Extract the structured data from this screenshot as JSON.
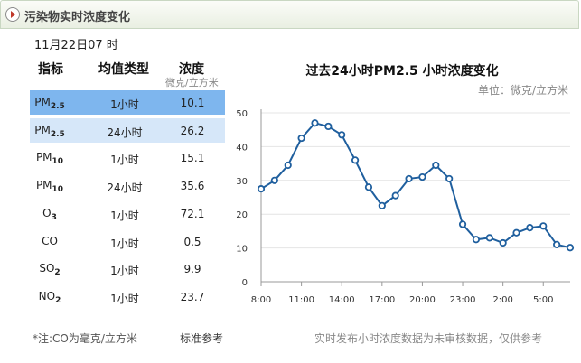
{
  "window": {
    "title": "污染物实时浓度变化"
  },
  "datetime": "11月22日07 时",
  "table": {
    "headers": {
      "indicator": "指标",
      "avg_type": "均值类型",
      "concentration": "浓度"
    },
    "unit": "微克/立方米",
    "rows": [
      {
        "base": "PM",
        "sub": "2.5",
        "type": "1小时",
        "value": "10.1"
      },
      {
        "base": "PM",
        "sub": "2.5",
        "type": "24小时",
        "value": "26.2"
      },
      {
        "base": "PM",
        "sub": "10",
        "type": "1小时",
        "value": "15.1"
      },
      {
        "base": "PM",
        "sub": "10",
        "type": "24小时",
        "value": "35.6"
      },
      {
        "base": "O",
        "sub": "3",
        "type": "1小时",
        "value": "72.1"
      },
      {
        "base": "CO",
        "sub": "",
        "type": "1小时",
        "value": "0.5"
      },
      {
        "base": "SO",
        "sub": "2",
        "type": "1小时",
        "value": "9.9"
      },
      {
        "base": "NO",
        "sub": "2",
        "type": "1小时",
        "value": "23.7"
      }
    ]
  },
  "footer": {
    "note": "*注:CO为毫克/立方米",
    "standard_link": "标准参考",
    "disclaimer": "实时发布小时浓度数据为未审核数据，仅供参考"
  },
  "colors": {
    "line": "#1f5f9e",
    "highlight_row": "#7eb6ee",
    "light_row": "#d6e7f9"
  },
  "chart_data": {
    "type": "line",
    "title": "过去24小时PM2.5 小时浓度变化",
    "unit_label": "单位：微克/立方米",
    "ylim": [
      0,
      50
    ],
    "yticks": [
      0,
      10,
      20,
      30,
      40,
      50
    ],
    "xtick_labels": [
      "8:00",
      "11:00",
      "14:00",
      "17:00",
      "20:00",
      "23:00",
      "2:00",
      "5:00"
    ],
    "grid": true,
    "series": [
      {
        "values": [
          27.5,
          30,
          34.5,
          42.5,
          47,
          46,
          43.5,
          36,
          28,
          22.5,
          25.5,
          30.5,
          31,
          34.5,
          30.5,
          17,
          12.5,
          13,
          11.5,
          14.5,
          16,
          16.5,
          11,
          10.1
        ]
      }
    ]
  }
}
